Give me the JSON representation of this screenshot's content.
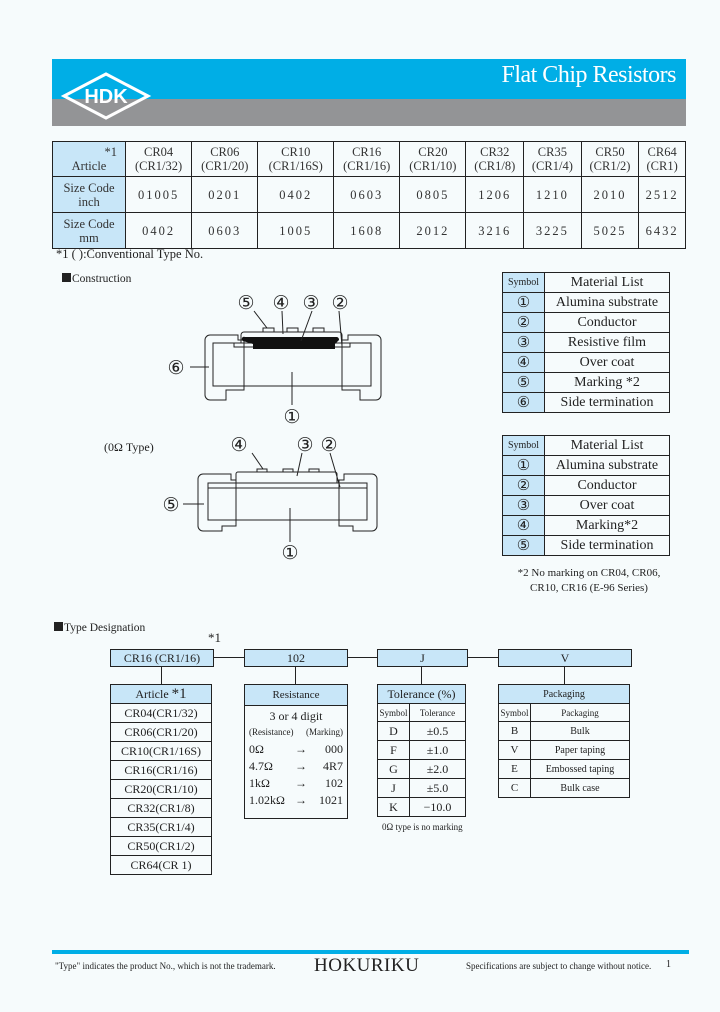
{
  "header": {
    "logo_text": "HDK",
    "title": "Flat Chip Resistors",
    "colors": {
      "accent_blue": "#00aee6",
      "band_gray": "#939496",
      "cell_blue": "#c8e6f8"
    }
  },
  "spec_table": {
    "corner_note": "*1",
    "row_headers": [
      "Article",
      "Size Code inch",
      "Size Code mm"
    ],
    "columns": [
      {
        "article": "CR04",
        "conventional": "(CR1/32)",
        "inch": "01005",
        "mm": "0402"
      },
      {
        "article": "CR06",
        "conventional": "(CR1/20)",
        "inch": "0201",
        "mm": "0603"
      },
      {
        "article": "CR10",
        "conventional": "(CR1/16S)",
        "inch": "0402",
        "mm": "1005"
      },
      {
        "article": "CR16",
        "conventional": "(CR1/16)",
        "inch": "0603",
        "mm": "1608"
      },
      {
        "article": "CR20",
        "conventional": "(CR1/10)",
        "inch": "0805",
        "mm": "2012"
      },
      {
        "article": "CR32",
        "conventional": "(CR1/8)",
        "inch": "1206",
        "mm": "3216"
      },
      {
        "article": "CR35",
        "conventional": "(CR1/4)",
        "inch": "1210",
        "mm": "3225"
      },
      {
        "article": "CR50",
        "conventional": "(CR1/2)",
        "inch": "2010",
        "mm": "5025"
      },
      {
        "article": "CR64",
        "conventional": "(CR1)",
        "inch": "2512",
        "mm": "6432"
      }
    ],
    "note": "*1 (   ):Conventional Type No."
  },
  "construction": {
    "heading": "Construction",
    "zero_ohm_label": "(0Ω Type)",
    "diagram1_labels": [
      "⑤",
      "④",
      "③",
      "②",
      "⑥",
      "①"
    ],
    "diagram2_labels": [
      "④",
      "③",
      "②",
      "⑤",
      "①"
    ]
  },
  "material_list_1": {
    "header_symbol": "Symbol",
    "header_material": "Material List",
    "rows": [
      {
        "symbol": "①",
        "material": "Alumina substrate"
      },
      {
        "symbol": "②",
        "material": "Conductor"
      },
      {
        "symbol": "③",
        "material": "Resistive film"
      },
      {
        "symbol": "④",
        "material": "Over coat"
      },
      {
        "symbol": "⑤",
        "material": "Marking *2"
      },
      {
        "symbol": "⑥",
        "material": "Side termination"
      }
    ]
  },
  "material_list_2": {
    "header_symbol": "Symbol",
    "header_material": "Material List",
    "rows": [
      {
        "symbol": "①",
        "material": "Alumina substrate"
      },
      {
        "symbol": "②",
        "material": "Conductor"
      },
      {
        "symbol": "③",
        "material": "Over coat"
      },
      {
        "symbol": "④",
        "material": "Marking*2"
      },
      {
        "symbol": "⑤",
        "material": "Side termination"
      }
    ],
    "note_line1": "*2 No marking on CR04, CR06,",
    "note_line2": "CR10, CR16 (E-96 Series)"
  },
  "type_designation": {
    "heading": "Type Designation",
    "star_note": "*1",
    "example": [
      "CR16 (CR1/16)",
      "102",
      "J",
      "V"
    ],
    "article": {
      "header": "Article",
      "header_note": "*1",
      "items": [
        "CR04(CR1/32)",
        "CR06(CR1/20)",
        "CR10(CR1/16S)",
        "CR16(CR1/16)",
        "CR20(CR1/10)",
        "CR32(CR1/8)",
        "CR35(CR1/4)",
        "CR50(CR1/2)",
        "CR64(CR 1)"
      ]
    },
    "resistance": {
      "header": "Resistance",
      "subtitle": "3 or 4 digit",
      "col_resistance": "(Resistance)",
      "col_marking": "(Marking)",
      "arrow": "→",
      "rows": [
        {
          "resistance": "0Ω",
          "marking": "000"
        },
        {
          "resistance": "4.7Ω",
          "marking": "4R7"
        },
        {
          "resistance": "1kΩ",
          "marking": "102"
        },
        {
          "resistance": "1.02kΩ",
          "marking": "1021"
        }
      ]
    },
    "tolerance": {
      "header": "Tolerance (%)",
      "col_symbol": "Symbol",
      "col_tolerance": "Tolerance",
      "rows": [
        {
          "symbol": "D",
          "value": "±0.5"
        },
        {
          "symbol": "F",
          "value": "±1.0"
        },
        {
          "symbol": "G",
          "value": "±2.0"
        },
        {
          "symbol": "J",
          "value": "±5.0"
        },
        {
          "symbol": "K",
          "value": "−10.0"
        }
      ],
      "note": "0Ω type is no marking"
    },
    "packaging": {
      "header": "Packaging",
      "col_symbol": "Symbol",
      "col_packaging": "Packaging",
      "rows": [
        {
          "symbol": "B",
          "value": "Bulk"
        },
        {
          "symbol": "V",
          "value": "Paper taping"
        },
        {
          "symbol": "E",
          "value": "Embossed taping"
        },
        {
          "symbol": "C",
          "value": "Bulk case"
        }
      ]
    }
  },
  "footer": {
    "left_note": "\"Type\" indicates the product No., which is not the trademark.",
    "brand": "HOKURIKU",
    "right_note": "Specifications are subject to change without notice.",
    "page": "1"
  }
}
